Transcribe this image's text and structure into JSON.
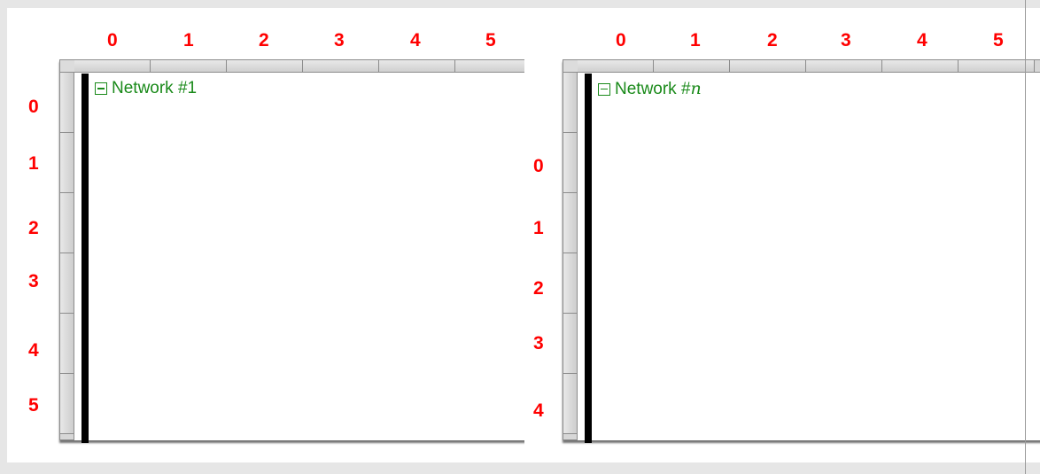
{
  "left": {
    "network_prefix": "Network #",
    "network_number": "1",
    "col_labels": [
      "0",
      "1",
      "2",
      "3",
      "4",
      "5"
    ],
    "row_labels": [
      "0",
      "1",
      "2",
      "3",
      "4",
      "5"
    ]
  },
  "right": {
    "network_prefix": "Network #",
    "network_number": "n",
    "col_labels": [
      "0",
      "1",
      "2",
      "3",
      "4",
      "5"
    ],
    "row_labels": [
      "0",
      "1",
      "2",
      "3",
      "4"
    ]
  },
  "colors": {
    "labels": "#ff0000",
    "network_title": "#1a8a1a",
    "power_rail": "#000000",
    "background": "#e6e6e6"
  },
  "icons": {
    "collapse": "collapse-icon"
  }
}
